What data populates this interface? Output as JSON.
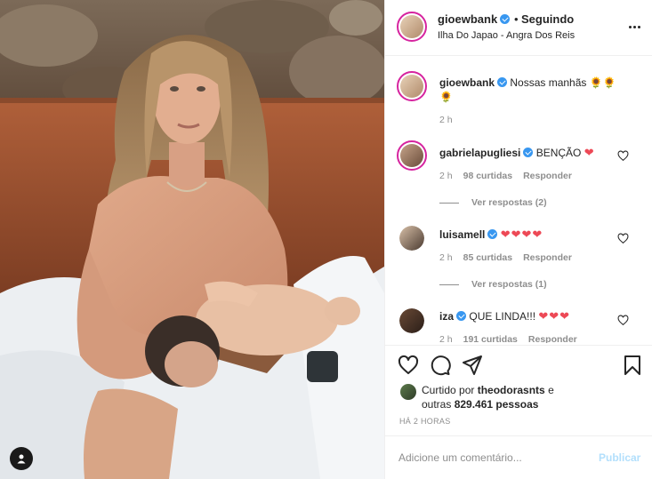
{
  "post": {
    "username": "gioewbank",
    "follow_status": "Seguindo",
    "separator": "•",
    "location": "Ilha Do Japao - Angra Dos Reis"
  },
  "caption": {
    "username": "gioewbank",
    "text": "Nossas manhãs 🌻🌻",
    "emoji_line2": "🌻",
    "time": "2 h"
  },
  "comments": [
    {
      "username": "gabrielapugliesi",
      "text": "BENÇÃO",
      "hearts": "❤",
      "time": "2 h",
      "likes": "98 curtidas",
      "reply": "Responder",
      "view_replies": "Ver respostas (2)"
    },
    {
      "username": "luisamell",
      "text": "",
      "hearts": "❤❤❤❤",
      "time": "2 h",
      "likes": "85 curtidas",
      "reply": "Responder",
      "view_replies": "Ver respostas (1)"
    },
    {
      "username": "iza",
      "text": "QUE LINDA!!!",
      "hearts": "❤❤❤",
      "time": "2 h",
      "likes": "191 curtidas",
      "reply": "Responder"
    }
  ],
  "likes": {
    "prefix": "Curtido por",
    "user": "theodorasnts",
    "middle": "e",
    "others_prefix": "outras",
    "count": "829.461 pessoas"
  },
  "time_ago": "HÁ 2 HORAS",
  "composer": {
    "placeholder": "Adicione um comentário...",
    "publish_label": "Publicar"
  },
  "colors": {
    "verified": "#3897f0",
    "heart_red": "#ed4956",
    "publish_disabled": "#b2dffc",
    "muted_text": "#8e8e8e"
  },
  "icons": [
    "heart-icon",
    "comment-icon",
    "share-icon",
    "bookmark-icon",
    "more-icon",
    "user-tag-icon",
    "verified-badge-icon"
  ]
}
